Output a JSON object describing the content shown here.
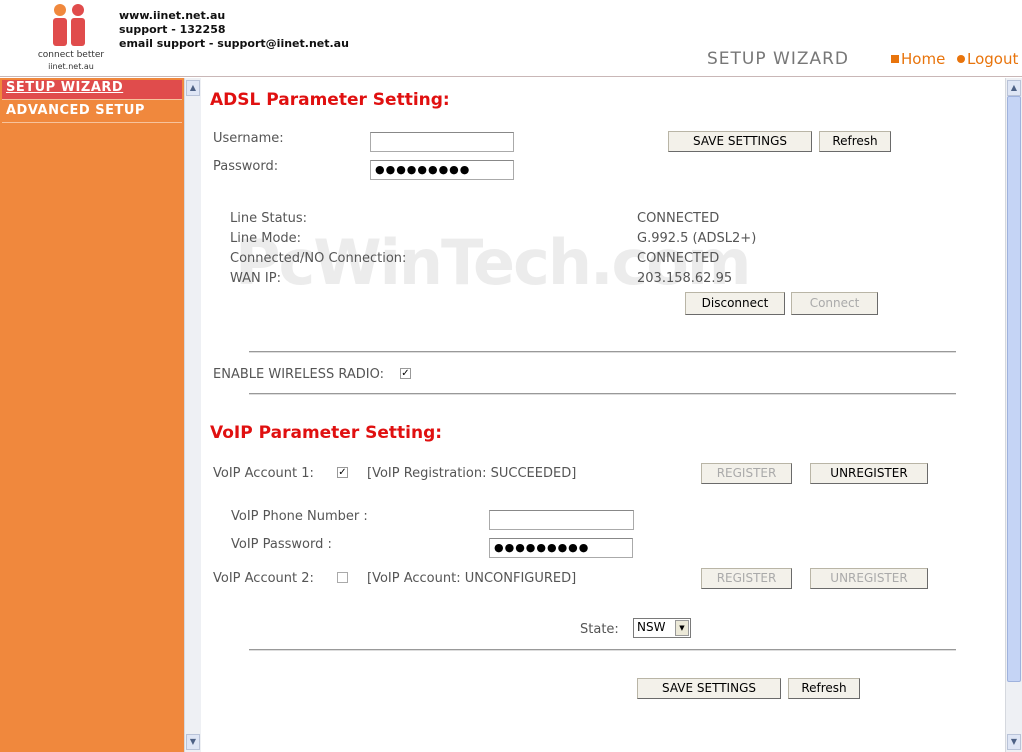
{
  "header": {
    "logo_tagline": "connect better",
    "logo_url": "iinet.net.au",
    "contact": [
      "www.iinet.net.au",
      "support - 132258",
      "email support - support@iinet.net.au"
    ],
    "page_title": "SETUP WIZARD",
    "links": {
      "home": "Home",
      "logout": "Logout"
    },
    "brand_color": "#e8740c"
  },
  "sidebar": {
    "items": [
      {
        "label": "SETUP WIZARD",
        "active": true
      },
      {
        "label": "ADVANCED SETUP",
        "active": false
      }
    ]
  },
  "adsl": {
    "title": "ADSL Parameter Setting:",
    "username_label": "Username:",
    "username_value": "",
    "password_label": "Password:",
    "password_value": "●●●●●●●●●",
    "save_label": "SAVE SETTINGS",
    "refresh_label": "Refresh",
    "status": [
      {
        "label": "Line Status:",
        "value": "CONNECTED"
      },
      {
        "label": "Line Mode:",
        "value": "G.992.5 (ADSL2+)"
      },
      {
        "label": "Connected/NO Connection:",
        "value": "CONNECTED"
      },
      {
        "label": "WAN IP:",
        "value": "203.158.62.95"
      }
    ],
    "disconnect_label": "Disconnect",
    "connect_label": "Connect"
  },
  "wireless": {
    "label": "ENABLE WIRELESS RADIO:",
    "checked": true
  },
  "voip": {
    "title": "VoIP Parameter Setting:",
    "account1_label": "VoIP Account 1:",
    "account1_status": "[VoIP Registration: SUCCEEDED]",
    "phone_label": "VoIP Phone Number :",
    "phone_value": "",
    "password_label": "VoIP Password :",
    "password_value": "●●●●●●●●●",
    "account2_label": "VoIP Account 2:",
    "account2_status": "[VoIP Account: UNCONFIGURED]",
    "register_label": "REGISTER",
    "unregister_label": "UNREGISTER",
    "state_label": "State:",
    "state_value": "NSW",
    "save_label": "SAVE SETTINGS",
    "refresh_label": "Refresh"
  },
  "watermark": "PcWinTech.com"
}
